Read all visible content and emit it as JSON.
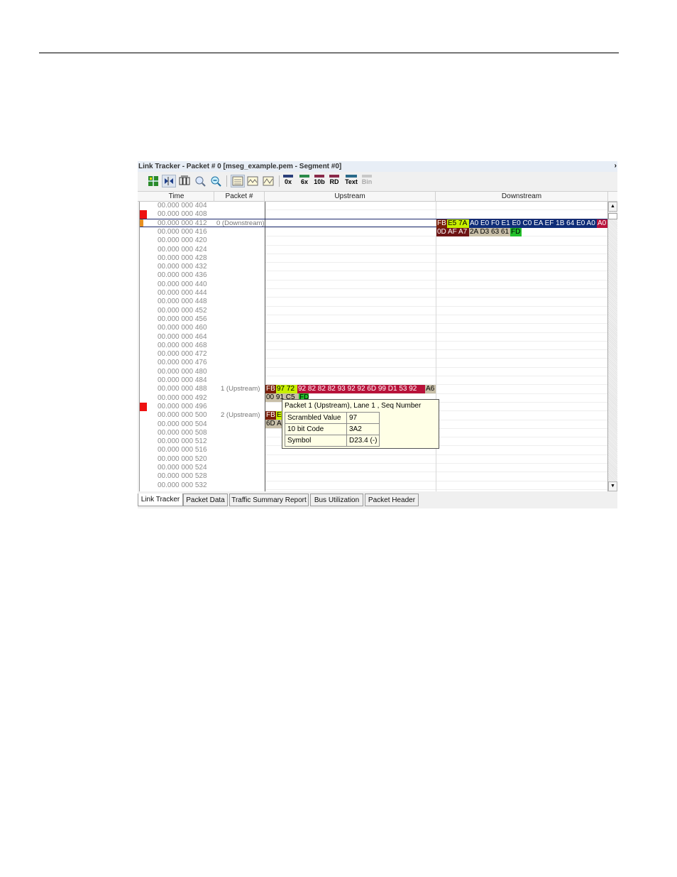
{
  "window": {
    "title": "Link Tracker - Packet # 0 [mseg_example.pem - Segment #0]",
    "collapse_glyph": "›"
  },
  "toolbar": {
    "icons": [
      "grid-icon",
      "link-arrows-icon",
      "lane-view-icon",
      "zoom-in-icon",
      "zoom-out-icon",
      "row-view-icon",
      "wave-view-icon",
      "wave-alt-view-icon"
    ],
    "formats": [
      "0x",
      "6x",
      "10b",
      "RD",
      "Text",
      "Bin"
    ]
  },
  "columns": {
    "time": "Time",
    "packet": "Packet #",
    "upstream": "Upstream",
    "downstream": "Downstream"
  },
  "times": [
    "00.000 000 404",
    "00.000 000 408",
    "00.000 000 412",
    "00.000 000 416",
    "00.000 000 420",
    "00.000 000 424",
    "00.000 000 428",
    "00.000 000 432",
    "00.000 000 436",
    "00.000 000 440",
    "00.000 000 444",
    "00.000 000 448",
    "00.000 000 452",
    "00.000 000 456",
    "00.000 000 460",
    "00.000 000 464",
    "00.000 000 468",
    "00.000 000 472",
    "00.000 000 476",
    "00.000 000 480",
    "00.000 000 484",
    "00.000 000 488",
    "00.000 000 492",
    "00.000 000 496",
    "00.000 000 500",
    "00.000 000 504",
    "00.000 000 508",
    "00.000 000 512",
    "00.000 000 516",
    "00.000 000 520",
    "00.000 000 524",
    "00.000 000 528",
    "00.000 000 532"
  ],
  "packets": {
    "p0": "0 (Downstream)",
    "p1": "1 (Upstream)",
    "p2": "2 (Upstream)"
  },
  "downstream_symbols": {
    "row1": [
      "FB",
      "E5 7A",
      "A0 E0 F0 E1 E0 C0 EA EF 1B 64 E0 A0",
      "A0"
    ],
    "row2": [
      "0D AF A7",
      "2A D3 63 61",
      "FD"
    ]
  },
  "upstream_symbols": {
    "p1_row1": [
      "FB",
      "97 72",
      "92 82 82 82 93 92 92 6D 99 D1 53 92",
      "A6"
    ],
    "p1_row2": [
      "00 91 C5",
      "FD"
    ],
    "p2_row1": [
      "FB",
      "E"
    ],
    "p2_row2": [
      "6D A"
    ]
  },
  "tooltip": {
    "title": "Packet 1 (Upstream), Lane 1 , Seq Number",
    "rows": [
      {
        "label": "Scrambled Value",
        "value": "97"
      },
      {
        "label": "10 bit Code",
        "value": "3A2"
      },
      {
        "label": "Symbol",
        "value": "D23.4 (-)"
      }
    ]
  },
  "tabs": [
    "Link Tracker",
    "Packet Data",
    "Traffic Summary Report",
    "Bus Utilization",
    "Packet Header"
  ],
  "colors": {
    "fb_brown": "#7a1f0a",
    "lime": "#c8f000",
    "navy": "#0f2d78",
    "crimson": "#b8123a",
    "tan": "#c8bfa8",
    "green": "#22c02a",
    "marker_red": "#ee1111",
    "marker_orange": "#e89020"
  }
}
